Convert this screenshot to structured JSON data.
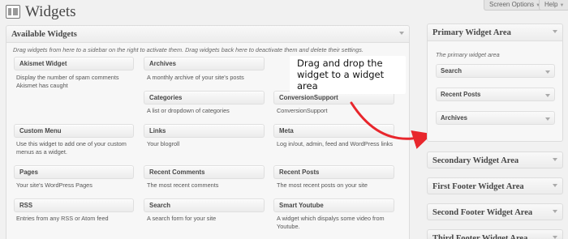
{
  "header": {
    "title": "Widgets",
    "screen_options": "Screen Options",
    "help": "Help"
  },
  "available": {
    "title": "Available Widgets",
    "description": "Drag widgets from here to a sidebar on the right to activate them. Drag widgets back here to deactivate them and delete their settings.",
    "widgets": [
      {
        "title": "Akismet Widget",
        "desc": "Display the number of spam comments Akismet has caught"
      },
      {
        "title": "Archives",
        "desc": "A monthly archive of your site's posts"
      },
      {
        "title": "Categories",
        "desc": "A list or dropdown of categories"
      },
      {
        "title": "ConversionSupport",
        "desc": "ConversionSupport"
      },
      {
        "title": "Custom Menu",
        "desc": "Use this widget to add one of your custom menus as a widget."
      },
      {
        "title": "Links",
        "desc": "Your blogroll"
      },
      {
        "title": "Meta",
        "desc": "Log in/out, admin, feed and WordPress links"
      },
      {
        "title": "Pages",
        "desc": "Your site's WordPress Pages"
      },
      {
        "title": "Recent Comments",
        "desc": "The most recent comments"
      },
      {
        "title": "Recent Posts",
        "desc": "The most recent posts on your site"
      },
      {
        "title": "RSS",
        "desc": "Entries from any RSS or Atom feed"
      },
      {
        "title": "Search",
        "desc": "A search form for your site"
      },
      {
        "title": "Smart Youtube",
        "desc": "A widget which dispalys some video from Youtube."
      }
    ]
  },
  "callout": {
    "text": "Drag and drop the widget to a widget area"
  },
  "primary_area": {
    "title": "Primary Widget Area",
    "description": "The primary widget area",
    "widgets": [
      "Search",
      "Recent Posts",
      "Archives"
    ]
  },
  "other_areas": [
    "Secondary Widget Area",
    "First Footer Widget Area",
    "Second Footer Widget Area",
    "Third Footer Widget Area"
  ],
  "colors": {
    "arrow": "#e8262c",
    "background": "#f1f1f1"
  }
}
